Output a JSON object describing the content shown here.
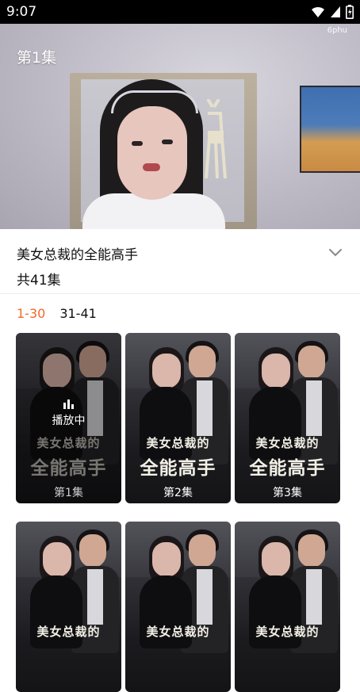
{
  "status_bar": {
    "time": "9:07",
    "icons": [
      "wifi-icon",
      "signal-icon",
      "battery-icon"
    ]
  },
  "player": {
    "episode_overlay": "第1集",
    "watermark": "6phu"
  },
  "info": {
    "title": "美女总裁的全能高手",
    "episode_count": "共41集",
    "expand_icon": "chevron-down-icon"
  },
  "range_tabs": [
    {
      "label": "1-30",
      "active": true
    },
    {
      "label": "31-41",
      "active": false
    }
  ],
  "poster_text": {
    "line1": "美女总裁的",
    "line2": "全能高手"
  },
  "episodes": [
    {
      "label": "第1集",
      "playing": true,
      "playing_text": "播放中"
    },
    {
      "label": "第2集",
      "playing": false
    },
    {
      "label": "第3集",
      "playing": false
    },
    {
      "label": "",
      "playing": false
    },
    {
      "label": "",
      "playing": false
    },
    {
      "label": "",
      "playing": false
    }
  ],
  "colors": {
    "accent": "#f06a2a",
    "status_bar_bg": "#000000"
  }
}
